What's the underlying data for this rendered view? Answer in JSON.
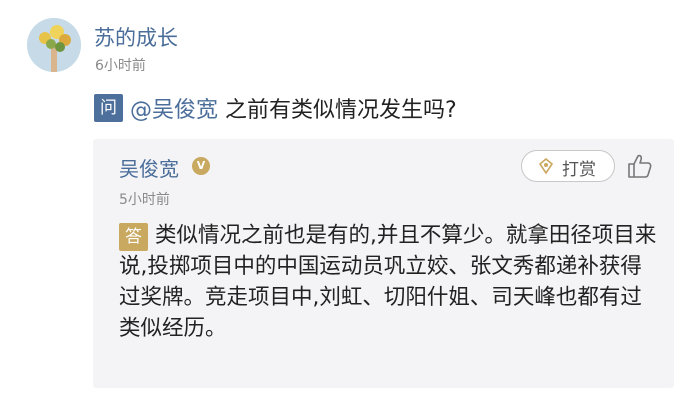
{
  "asker": {
    "name": "苏的成长",
    "time": "6小时前"
  },
  "question": {
    "badge": "问",
    "mention": "@吴俊宽",
    "text": " 之前有类似情况发生吗?"
  },
  "answer": {
    "author": "吴俊宽",
    "verified_icon": "verified-v-icon",
    "tip_label": "打赏",
    "like_icon": "thumbs-up-icon",
    "time": "5小时前",
    "badge": "答",
    "text": "类似情况之前也是有的,并且不算少。就拿田径项目来说,投掷项目中的中国运动员巩立姣、张文秀都递补获得过奖牌。竞走项目中,刘虹、切阳什姐、司天峰也都有过类似经历。"
  },
  "colors": {
    "name_blue": "#4a6d9a",
    "question_badge": "#4d6f9c",
    "answer_badge": "#c9a85f",
    "card_bg": "#f4f4f6"
  }
}
